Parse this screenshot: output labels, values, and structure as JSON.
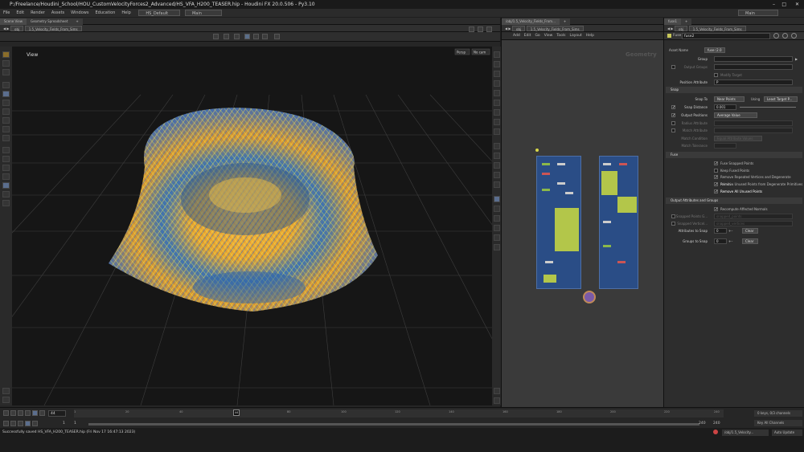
{
  "window": {
    "title": "P:/Freelance/Houdini_School/HOU_CustomVelocityForces2_Advanced/HS_VFA_H200_TEASER.hip - Houdini FX 20.0.506 - Py3.10"
  },
  "menu": {
    "items": [
      "File",
      "Edit",
      "Render",
      "Assets",
      "Windows",
      "Education",
      "Help"
    ],
    "desktop": "HS_Default",
    "main": "Main",
    "right": "Main"
  },
  "left_pane": {
    "tabs": [
      "Scene View",
      "Geometry Spreadsheet"
    ],
    "path": {
      "context": "obj",
      "node": "1.5_Velocity_Fields_From_Sims"
    },
    "viewport_label": "View",
    "persp": "Persp",
    "camera": "No cam"
  },
  "center_pane": {
    "tabs": [
      "/obj/1.5_Velocity_Fields_From..."
    ],
    "path": {
      "context": "obj",
      "node": "1.5_Velocity_Fields_From_Sims"
    },
    "menus": [
      "Add",
      "Edit",
      "Go",
      "View",
      "Tools",
      "Layout",
      "Help"
    ],
    "watermark": "Geometry"
  },
  "params": {
    "tabs": [
      "fuse1"
    ],
    "path": {
      "context": "obj",
      "node": "1.5_Velocity_Fields_From_Sims"
    },
    "node_type": "Fuse",
    "node_name": "fuse2",
    "asset_name_label": "Asset Name",
    "asset_name_value": "fuse::2.0",
    "group_label": "Group",
    "output_groups_label": "Output Groups",
    "modify_target_label": "Modify Target",
    "position_attribute_label": "Position Attribute",
    "position_attribute_value": "P",
    "snap_section": "Snap",
    "snap_to_label": "Snap To",
    "snap_to_value": "Near Points",
    "using_label": "Using",
    "using_value": "Least Target P...",
    "snap_distance_label": "Snap Distance",
    "snap_distance_value": "0.001",
    "output_positions_label": "Output Positions",
    "output_positions_value": "Average Value",
    "radius_attribute_label": "Radius Attribute",
    "match_attribute_label": "Match Attribute",
    "match_condition_label": "Match Condition",
    "match_condition_value": "Equal Attribute Values",
    "match_tolerance_label": "Match Tolerance",
    "fuse_section": "Fuse",
    "fuse_options": [
      {
        "label": "Fuse Snapped Points",
        "checked": true
      },
      {
        "label": "Keep Fused Points",
        "checked": false
      },
      {
        "label": "Remove Repeated Vertices and Degenerate Primiti...",
        "checked": true
      },
      {
        "label": "Remove Unused Points from Degenerate Primitives",
        "checked": true
      },
      {
        "label": "Remove All Unused Points",
        "checked": true
      }
    ],
    "output_section": "Output Attributes and Groups",
    "recompute_label": "Recompute Affected Normals",
    "snapped_points_label": "Snapped Points G...",
    "snapped_points_value": "snapped_points",
    "snapped_vertices_label": "Snapped Verticel...",
    "snapped_vertices_value": "snapped_vertices",
    "attributes_to_snap_label": "Attributes to Snap",
    "attributes_to_snap_value": "0",
    "groups_to_snap_label": "Groups to Snap",
    "groups_to_snap_value": "0",
    "clear_label": "Clear"
  },
  "timeline": {
    "current_frame": "44",
    "ticks": [
      "1",
      "20",
      "40",
      "60",
      "80",
      "100",
      "120",
      "140",
      "160",
      "180",
      "200",
      "220",
      "240"
    ],
    "current_marker": "44",
    "start": "1",
    "start2": "1",
    "end": "240",
    "end2": "240"
  },
  "status": {
    "message": "Successfully saved HS_VFA_H200_TEASER.hip (Fri Nov 17 16:47:13 2023)",
    "keys_info": "0 keys, 0/3 channels",
    "key_all": "Key All Channels",
    "auto_update": "Auto Update",
    "path_indicator": "/obj/1.5_Velocity..."
  }
}
